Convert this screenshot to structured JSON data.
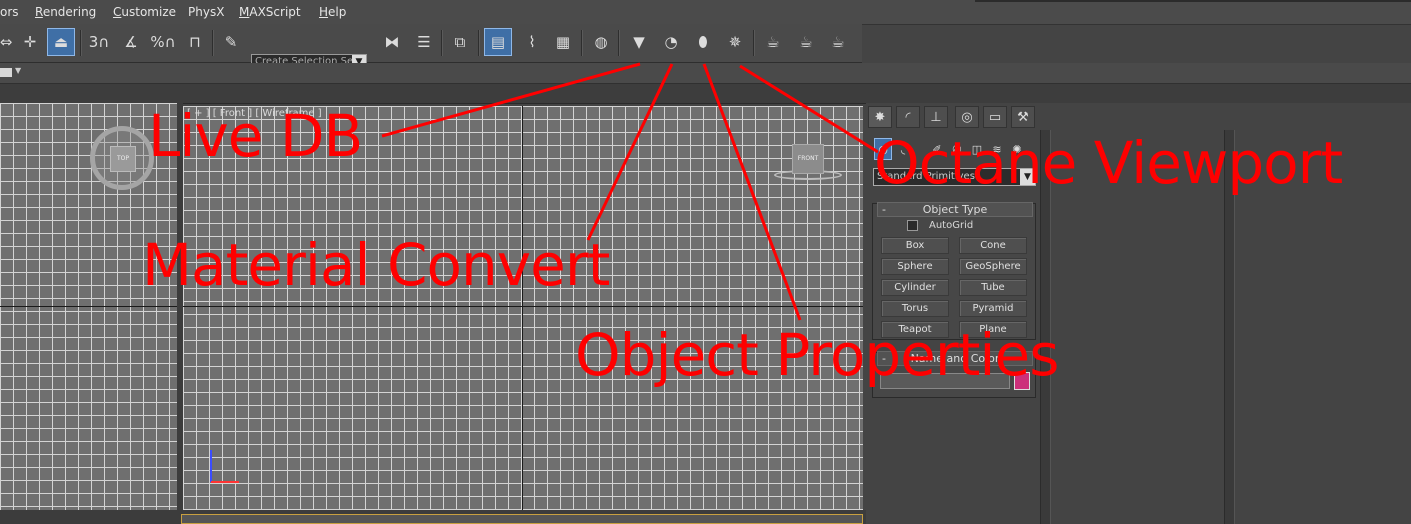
{
  "menu": {
    "items": [
      {
        "label": "ors",
        "accel": ""
      },
      {
        "label": "Rendering",
        "accel": "R"
      },
      {
        "label": "Customize",
        "accel": "C"
      },
      {
        "label": "PhysX",
        "accel": ""
      },
      {
        "label": "MAXScript",
        "accel": "M"
      },
      {
        "label": "Help",
        "accel": "H"
      }
    ]
  },
  "toolbar": {
    "selection_set_placeholder": "Create Selection Se",
    "snap_3d": "3",
    "percent": "%"
  },
  "viewports": {
    "front_label": "[ + ] [ Front ] [ Wireframe ]",
    "viewcube_top": "TOP",
    "viewcube_front": "FRONT"
  },
  "command_panel": {
    "dropdown_value": "Standard Primitives",
    "object_type": {
      "title": "Object Type",
      "collapse": "-",
      "autogrid": "AutoGrid",
      "buttons": [
        "Box",
        "Cone",
        "Sphere",
        "GeoSphere",
        "Cylinder",
        "Tube",
        "Torus",
        "Pyramid",
        "Teapot",
        "Plane"
      ]
    },
    "name_color": {
      "title": "Name and Color",
      "collapse": "-",
      "swatch_color": "#cc2f7a"
    }
  },
  "annotations": {
    "color": "#ff0000",
    "live_db": "Live DB",
    "material_convert": "Material Convert",
    "object_properties": "Object Properties",
    "octane_viewport": "Octane Viewport"
  }
}
